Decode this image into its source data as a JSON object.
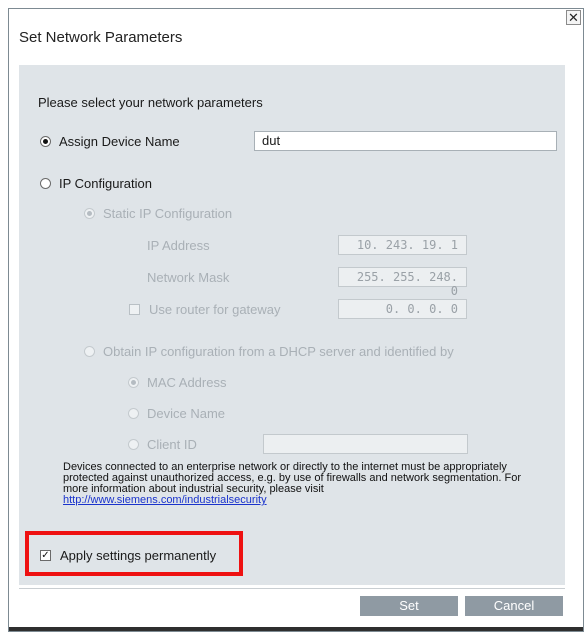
{
  "dialog": {
    "title": "Set Network Parameters",
    "close_glyph": "✕"
  },
  "content": {
    "prompt": "Please select your network parameters",
    "assign_device_name": {
      "label": "Assign Device Name",
      "value": "dut",
      "selected": true
    },
    "ip_configuration": {
      "label": "IP Configuration",
      "selected": false,
      "static": {
        "label": "Static IP Configuration",
        "ip_address_label": "IP Address",
        "ip_address_value": "10. 243.  19.  1",
        "network_mask_label": "Network Mask",
        "network_mask_value": "255. 255. 248.  0",
        "gateway_label": "Use router for gateway",
        "gateway_value": "0.   0.   0.  0"
      },
      "dhcp": {
        "label": "Obtain IP configuration from a DHCP server and identified by",
        "mac_label": "MAC Address",
        "device_name_label": "Device Name",
        "client_id_label": "Client ID",
        "client_id_value": ""
      }
    },
    "security_note": {
      "text": "Devices connected to an enterprise network or directly to the internet must be appropriately protected against unauthorized access, e.g. by use of firewalls and network segmentation. For more information about industrial security, please visit ",
      "link": "http://www.siemens.com/industrialsecurity"
    },
    "apply_permanently": {
      "label": "Apply settings permanently",
      "checked": true,
      "check_glyph": "✓"
    }
  },
  "buttons": {
    "set": "Set",
    "cancel": "Cancel"
  },
  "colors": {
    "panel": "#dfe4e8",
    "button": "#8f9aa3",
    "highlight": "#ee1111",
    "link": "#1a33cc"
  }
}
